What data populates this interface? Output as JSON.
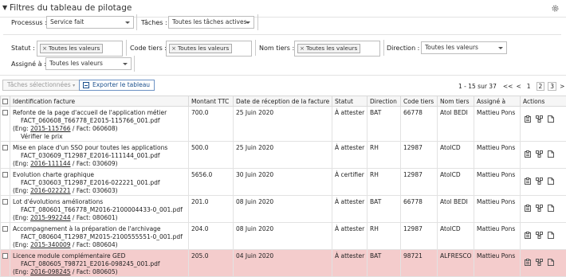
{
  "header": {
    "title": "Filtres du tableau de pilotage"
  },
  "filters": {
    "processus_label": "Processus :",
    "processus_value": "Service fait",
    "taches_label": "Tâches :",
    "taches_value": "Toutes les tâches actives",
    "statut_label": "Statut :",
    "statut_tag": "Toutes les valeurs",
    "code_tiers_label": "Code tiers :",
    "code_tiers_tag": "Toutes les valeurs",
    "nom_tiers_label": "Nom tiers :",
    "nom_tiers_tag": "Toutes les valeurs",
    "direction_label": "Direction :",
    "direction_value": "Toutes les valeurs",
    "assigne_label": "Assigné à :",
    "assigne_value": "Toutes les valeurs"
  },
  "toolbar": {
    "taches_selectionnees": "Tâches sélectionnées",
    "exporter": "Exporter le tableau"
  },
  "pager": {
    "range": "1 - 15 sur 37",
    "first": "<<",
    "prev": "<",
    "pages": [
      "1",
      "2",
      "3"
    ],
    "next": ">",
    "last": ">>"
  },
  "table": {
    "columns": [
      "Identification facture",
      "Montant TTC",
      "Date de réception de la facture",
      "Statut",
      "Direction",
      "Code tiers",
      "Nom tiers",
      "Assigné à",
      "Actions"
    ],
    "rows": [
      {
        "title": "Refonte de la page d'accueil de l'application métier",
        "file": "FACT_060608_T66778_E2015-115766_001.pdf",
        "eng_label": "(Eng: ",
        "eng": "2015-115766",
        "fact": " / Fact: 060608)",
        "extra": "Vérifier le prix",
        "montant": "700.0",
        "date": "25 Juin 2020",
        "statut": "À attester",
        "direction": "BAT",
        "code": "66778",
        "nom": "Atol BEDI",
        "assigne": "Mattieu Pons"
      },
      {
        "title": "Mise en place d'un SSO pour toutes les applications",
        "file": "FACT_030609_T12987_E2016-111144_001.pdf",
        "eng_label": "(Eng: ",
        "eng": "2016-111144",
        "fact": " / Fact: 030609)",
        "extra": "",
        "montant": "500.0",
        "date": "25 Juin 2020",
        "statut": "À attester",
        "direction": "RH",
        "code": "12987",
        "nom": "AtolCD",
        "assigne": "Mattieu Pons"
      },
      {
        "title": "Evolution charte graphique",
        "file": "FACT_030603_T12987_E2016-022221_001.pdf",
        "eng_label": "(Eng: ",
        "eng": "2016-022221",
        "fact": " / Fact: 030603)",
        "extra": "",
        "montant": "5656.0",
        "date": "30 Juin 2020",
        "statut": "À certifier",
        "direction": "RH",
        "code": "12987",
        "nom": "AtolCD",
        "assigne": "Mattieu Pons"
      },
      {
        "title": "Lot d'évolutions améliorations",
        "file": "FACT_080601_T66778_M2016-2100004433-0_001.pdf",
        "eng_label": "(Eng: ",
        "eng": "2015-992244",
        "fact": " / Fact: 080601)",
        "extra": "",
        "montant": "201.0",
        "date": "08 Juin 2020",
        "statut": "À attester",
        "direction": "BAT",
        "code": "66778",
        "nom": "Atol BEDI",
        "assigne": "Mattieu Pons"
      },
      {
        "title": "Accompagnement à la préparation de l'archivage",
        "file": "FACT_080604_T12987_M2015-2100555551-0_001.pdf",
        "eng_label": "(Eng: ",
        "eng": "2015-340009",
        "fact": " / Fact: 080604)",
        "extra": "",
        "montant": "204.0",
        "date": "08 Juin 2020",
        "statut": "À attester",
        "direction": "RH",
        "code": "12987",
        "nom": "AtolCD",
        "assigne": "Mattieu Pons"
      },
      {
        "title": "Licence module complémentaire GED",
        "file": "FACT_080605_T98721_E2016-098245_001.pdf",
        "eng_label": "(Eng: ",
        "eng": "2016-098245",
        "fact": " / Fact: 080605)",
        "extra": "",
        "montant": "205.0",
        "date": "04 Juin 2020",
        "statut": "À attester",
        "direction": "BAT",
        "code": "98721",
        "nom": "ALFRESCO",
        "assigne": "Mattieu Pons",
        "highlight": true
      }
    ]
  },
  "icons": {
    "collapse": "triangle-down-icon",
    "settings": "gear-icon",
    "export": "table-export-icon",
    "row_actions": [
      "clipboard-icon",
      "workflow-icon",
      "document-icon"
    ]
  },
  "colors": {
    "highlight_row": "#f4cccc",
    "export_button": "#1a4f8c"
  }
}
